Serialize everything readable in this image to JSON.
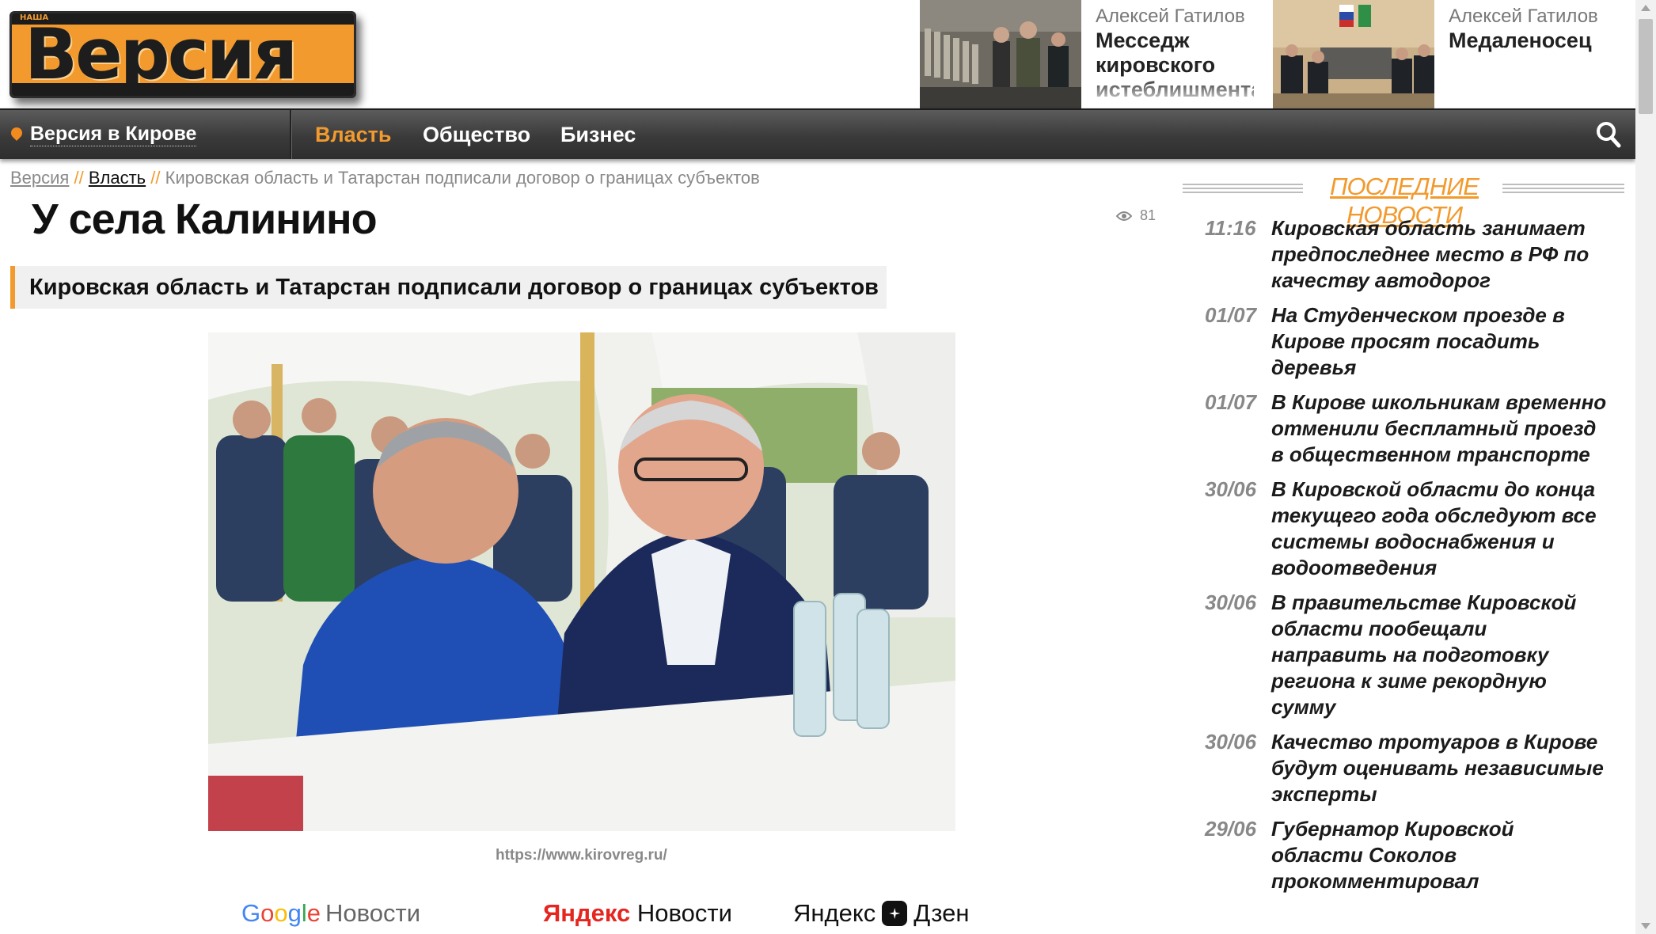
{
  "logo": {
    "tag": "НАША",
    "word": "Версия"
  },
  "promos": [
    {
      "author": "Алексей Гатилов",
      "title": "Месседж кировского истеблишмента"
    },
    {
      "author": "Алексей Гатилов",
      "title": "Медаленосец"
    }
  ],
  "nav": {
    "city": "Версия в Кирове",
    "items": [
      "Власть",
      "Общество",
      "Бизнес"
    ],
    "active_color": "#f29a2e"
  },
  "breadcrumb": {
    "home": "Версия",
    "sep": "//",
    "section": "Власть",
    "current": "Кировская область и Татарстан подписали договор о границах субъектов"
  },
  "article": {
    "title": "У села Калинино",
    "views": "81",
    "subtitle": "Кировская область и Татарстан подписали договор о границах субъектов",
    "photo_source": "https://www.kirovreg.ru/"
  },
  "aggregators": {
    "google_word": [
      "G",
      "o",
      "o",
      "g",
      "l",
      "e"
    ],
    "google_rest": "Новости",
    "yandex": "Яндекс",
    "yandex_rest": "Новости",
    "dzen_prefix": "Яндекс",
    "dzen": "Дзен"
  },
  "latest": {
    "title": "ПОСЛЕДНИЕ НОВОСТИ",
    "items": [
      {
        "time": "11:16",
        "text": "Кировская область занимает предпоследнее место в РФ по качеству автодорог"
      },
      {
        "time": "01/07",
        "text": "На Студенческом проезде в Кирове просят посадить деревья"
      },
      {
        "time": "01/07",
        "text": "В Кирове школьникам временно отменили бесплатный проезд в общественном транспорте"
      },
      {
        "time": "30/06",
        "text": "В Кировской области до конца текущего года обследуют все системы водоснабжения и водоотведения"
      },
      {
        "time": "30/06",
        "text": "В правительстве Кировской области пообещали направить на подготовку региона к зиме рекордную сумму"
      },
      {
        "time": "30/06",
        "text": "Качество тротуаров в Кирове будут оценивать независимые эксперты"
      },
      {
        "time": "29/06",
        "text": "Губернатор Кировской области Соколов прокомментировал"
      }
    ]
  },
  "colors": {
    "accent": "#f29a2e",
    "nav_bg": "#3a3a3a"
  },
  "icons": {
    "search": "search-icon",
    "pin": "location-pin-icon",
    "eye": "eye-icon"
  }
}
